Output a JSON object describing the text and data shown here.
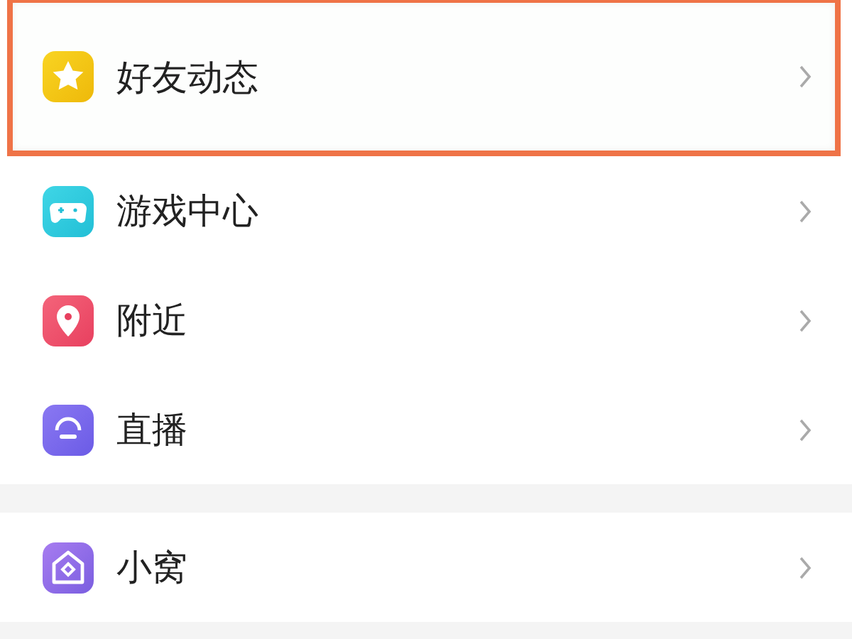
{
  "sections": [
    {
      "items": [
        {
          "label": "好友动态",
          "kind": "star",
          "highlighted": true
        },
        {
          "label": "游戏中心",
          "kind": "gamepad",
          "highlighted": false
        },
        {
          "label": "附近",
          "kind": "pin",
          "highlighted": false
        },
        {
          "label": "直播",
          "kind": "live",
          "highlighted": false
        }
      ]
    },
    {
      "items": [
        {
          "label": "小窝",
          "kind": "home",
          "highlighted": false
        }
      ]
    }
  ]
}
